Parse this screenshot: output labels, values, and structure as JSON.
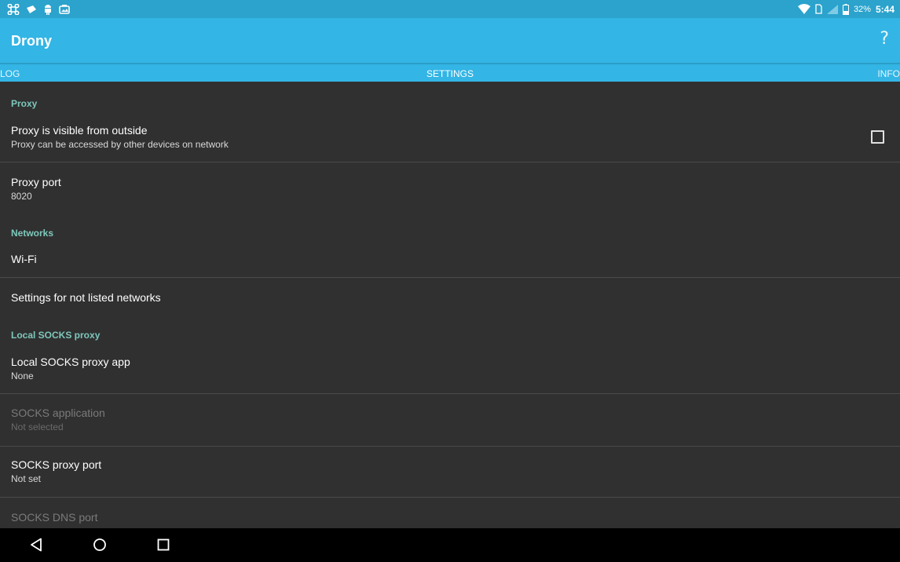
{
  "status_bar": {
    "battery_percent": "32%",
    "time": "5:44",
    "left_icons": [
      "cloverleaf-icon",
      "notification-icon",
      "android-icon",
      "photo-icon"
    ],
    "right_icons": [
      "wifi-icon",
      "sim-icon",
      "signal-icon",
      "battery-icon"
    ]
  },
  "app_bar": {
    "title": "Drony",
    "help_label": "?"
  },
  "tabs": {
    "log": "LOG",
    "settings": "SETTINGS",
    "info": "INFO"
  },
  "settings": {
    "proxy_category": "Proxy",
    "proxy_visible": {
      "title": "Proxy is visible from outside",
      "summary": "Proxy can be accessed by other devices on network",
      "checked": false
    },
    "proxy_port": {
      "title": "Proxy port",
      "summary": "8020"
    },
    "networks_category": "Networks",
    "wifi": {
      "title": "Wi-Fi"
    },
    "not_listed": {
      "title": "Settings for not listed networks"
    },
    "socks_category": "Local SOCKS proxy",
    "socks_app": {
      "title": "Local SOCKS proxy app",
      "summary": "None"
    },
    "socks_application": {
      "title": "SOCKS application",
      "summary": "Not selected",
      "enabled": false
    },
    "socks_port": {
      "title": "SOCKS proxy port",
      "summary": "Not set"
    },
    "socks_dns_port": {
      "title": "SOCKS DNS port",
      "enabled": false
    }
  },
  "colors": {
    "status_bar": "#2ba3cc",
    "app_bar": "#33b5e5",
    "background": "#303030",
    "category_text": "#7ec8bc",
    "nav_bar": "#000000"
  },
  "nav_bar": [
    "back-icon",
    "home-icon",
    "recents-icon"
  ]
}
